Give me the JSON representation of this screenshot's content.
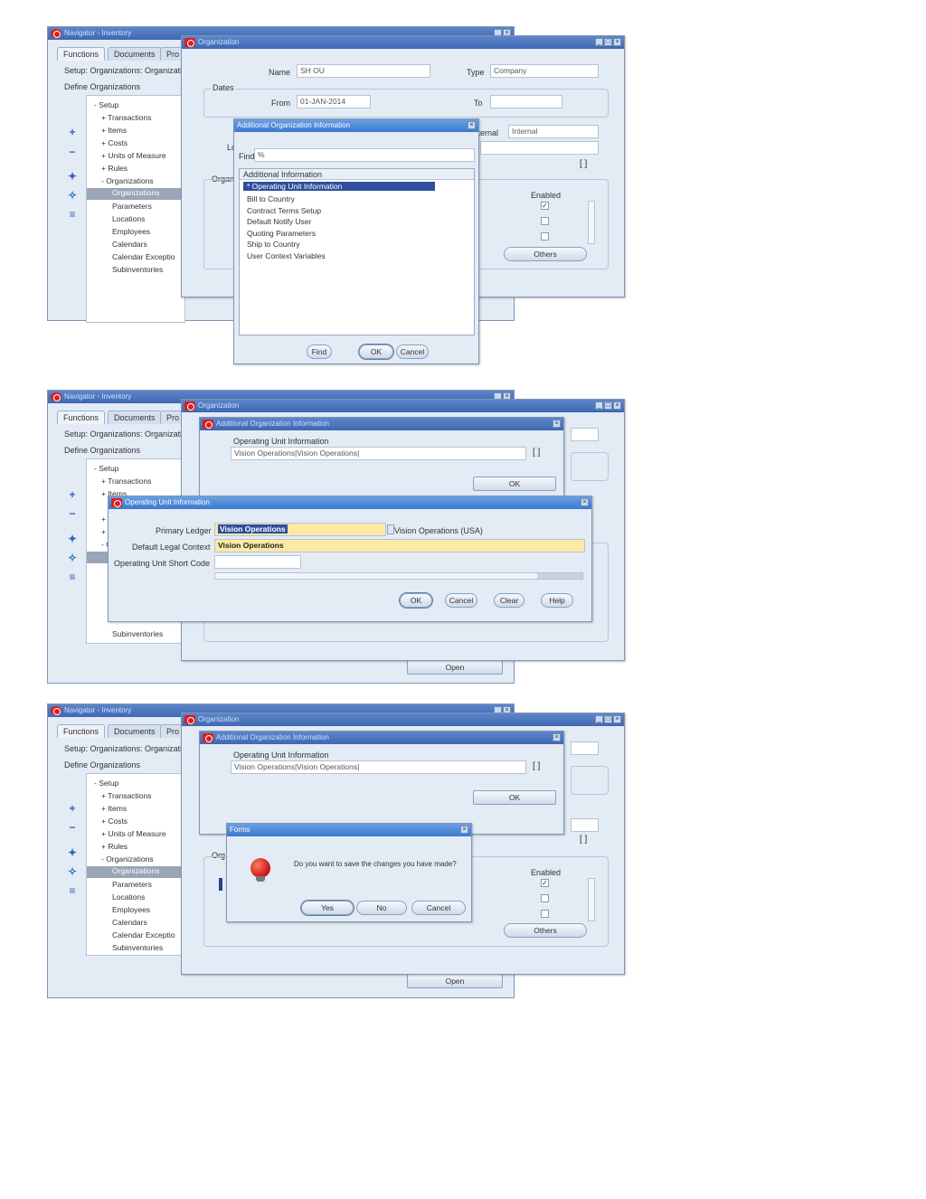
{
  "colors": {
    "titlebar": "#3b79cf",
    "window_bg": "#e3ebf5",
    "required_field": "#fce9a5",
    "selection": "#2e4f9d"
  },
  "navigator": {
    "title": "Navigator - Inventory",
    "tabs": [
      "Functions",
      "Documents",
      "Pro"
    ],
    "path": "Setup: Organizations: Organizati",
    "section": "Define Organizations",
    "tree": [
      "- Setup",
      "+ Transactions",
      "+ Items",
      "+ Costs",
      "+ Units of Measure",
      "+ Rules",
      "- Organizations",
      "Organizations",
      "Parameters",
      "Locations",
      "Employees",
      "Calendars",
      "Calendar Exceptio",
      "Subinventories"
    ],
    "tree_partial_2": [
      "+ U",
      "+ R",
      "- O"
    ],
    "tree_short_2": "+ Items",
    "open_label": "Open"
  },
  "org": {
    "title": "Organization",
    "name_label": "Name",
    "name_value": "SH OU",
    "type_label": "Type",
    "type_value": "Company",
    "dates_label": "Dates",
    "from_label": "From",
    "from_value": "01-JAN-2014",
    "to_label": "To",
    "internal_label": "Internal",
    "internal_value": "Internal",
    "loc_label": "Lo",
    "org_label": "Organ",
    "org_label_short": "Org",
    "enabled_label": "Enabled",
    "others_label": "Others",
    "bracket": "[ ]"
  },
  "addl_list": {
    "title": "Additional Organization Information",
    "find_label": "Find",
    "find_value": "%",
    "header": "Additional Information",
    "items": [
      "* Operating Unit Information",
      "Bill to Country",
      "Contract Terms Setup",
      "Default Notify User",
      "Quoting Parameters",
      "Ship to Country",
      "User Context Variables"
    ],
    "find_btn": "Find",
    "ok_btn": "OK",
    "cancel_btn": "Cancel"
  },
  "addl_form": {
    "title": "Additional Organization Information",
    "section": "Operating Unit Information",
    "value": "Vision Operations|Vision Operations|",
    "ok_btn": "OK"
  },
  "ou_info": {
    "title": "Operating Unit Information",
    "ledger_label": "Primary Ledger",
    "ledger_value": "Vision Operations",
    "ledger_desc": "Vision Operations (USA)",
    "legal_label": "Default Legal Context",
    "legal_value": "Vision Operations",
    "short_label": "Operating Unit Short Code",
    "ok_btn": "OK",
    "cancel_btn": "Cancel",
    "clear_btn": "Clear",
    "help_btn": "Help"
  },
  "forms_dialog": {
    "title": "Forms",
    "message": "Do you want to save the changes you have made?",
    "yes_btn": "Yes",
    "no_btn": "No",
    "cancel_btn": "Cancel"
  }
}
